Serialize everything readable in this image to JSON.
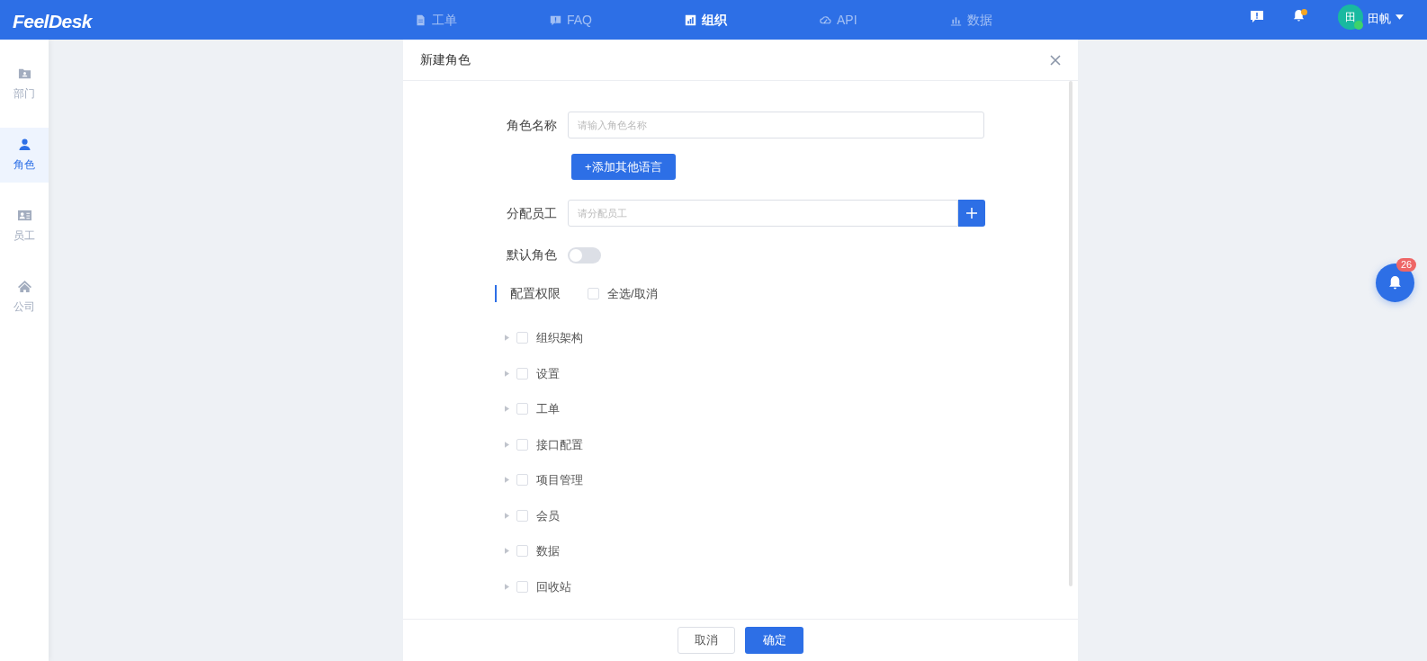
{
  "header": {
    "logo": "FeelDesk",
    "nav": [
      {
        "label": "工单",
        "selected": false
      },
      {
        "label": "FAQ",
        "selected": false
      },
      {
        "label": "组织",
        "selected": true
      },
      {
        "label": "API",
        "selected": false
      },
      {
        "label": "数据",
        "selected": false
      }
    ],
    "user": {
      "avatar": "田",
      "name": "田帆",
      "online": true
    },
    "notification_dot": true
  },
  "sidebar": {
    "items": [
      {
        "label": "部门",
        "selected": false
      },
      {
        "label": "角色",
        "selected": true
      },
      {
        "label": "员工",
        "selected": false
      },
      {
        "label": "公司",
        "selected": false
      }
    ]
  },
  "dialog": {
    "title": "新建角色",
    "role_name": {
      "label": "角色名称",
      "placeholder": "请输入角色名称"
    },
    "add_language_button": "+添加其他语言",
    "assign_staff": {
      "label": "分配员工",
      "placeholder": "请分配员工"
    },
    "default_role": {
      "label": "默认角色",
      "on": false
    },
    "permissions": {
      "label": "配置权限",
      "select_all": {
        "label": "全选/取消",
        "checked": false
      },
      "items": [
        {
          "label": "组织架构",
          "checked": false,
          "expanded": false
        },
        {
          "label": "设置",
          "checked": false,
          "expanded": false
        },
        {
          "label": "工单",
          "checked": false,
          "expanded": false
        },
        {
          "label": "接口配置",
          "checked": false,
          "expanded": false
        },
        {
          "label": "项目管理",
          "checked": false,
          "expanded": false
        },
        {
          "label": "会员",
          "checked": false,
          "expanded": false
        },
        {
          "label": "数据",
          "checked": false,
          "expanded": false
        },
        {
          "label": "回收站",
          "checked": false,
          "expanded": false
        }
      ]
    },
    "buttons": {
      "cancel": "取消",
      "confirm": "确定"
    }
  },
  "floating_bell": {
    "badge": "26"
  }
}
